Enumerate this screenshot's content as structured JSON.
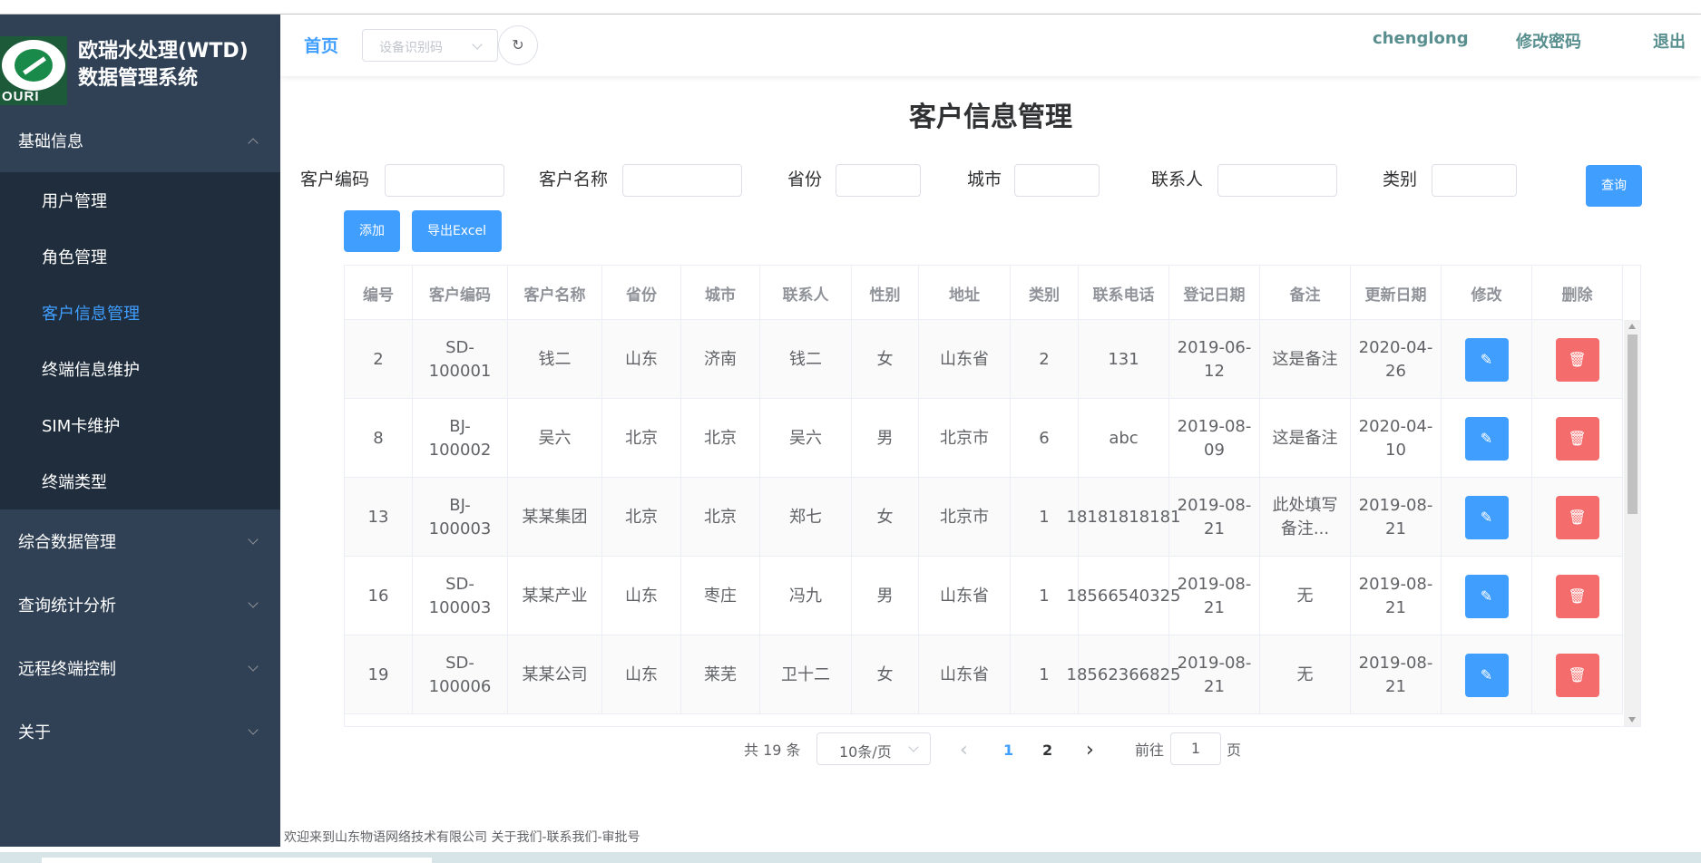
{
  "brand": {
    "logo_text": "OURI",
    "title_line1": "欧瑞水处理(WTD)",
    "title_line2": "数据管理系统"
  },
  "sidebar": {
    "groups": [
      {
        "label": "基础信息",
        "expanded": true,
        "items": [
          "用户管理",
          "角色管理",
          "客户信息管理",
          "终端信息维护",
          "SIM卡维护",
          "终端类型"
        ],
        "active_item": "客户信息管理"
      },
      {
        "label": "综合数据管理",
        "expanded": false
      },
      {
        "label": "查询统计分析",
        "expanded": false
      },
      {
        "label": "远程终端控制",
        "expanded": false
      },
      {
        "label": "关于",
        "expanded": false
      }
    ]
  },
  "header": {
    "home": "首页",
    "device_placeholder": "设备识别码",
    "refresh_icon": "↻",
    "username": "chenglong",
    "change_password": "修改密码",
    "logout": "退出"
  },
  "page_title": "客户信息管理",
  "filters": {
    "customer_code": "客户编码",
    "customer_name": "客户名称",
    "province": "省份",
    "city": "城市",
    "contact": "联系人",
    "category": "类别",
    "query_button": "查询"
  },
  "actions": {
    "add": "添加",
    "export": "导出Excel"
  },
  "table": {
    "columns": [
      "编号",
      "客户编码",
      "客户名称",
      "省份",
      "城市",
      "联系人",
      "性别",
      "地址",
      "类别",
      "联系电话",
      "登记日期",
      "备注",
      "更新日期",
      "修改",
      "删除"
    ],
    "rows": [
      {
        "id": "2",
        "code": "SD-100001",
        "name": "钱二",
        "province": "山东",
        "city": "济南",
        "contact": "钱二",
        "gender": "女",
        "address": "山东省",
        "category": "2",
        "phone": "131",
        "reg_date": "2019-06-12",
        "note": "这是备注",
        "update_date": "2020-04-26"
      },
      {
        "id": "8",
        "code": "BJ-100002",
        "name": "吴六",
        "province": "北京",
        "city": "北京",
        "contact": "吴六",
        "gender": "男",
        "address": "北京市",
        "category": "6",
        "phone": "abc",
        "reg_date": "2019-08-09",
        "note": "这是备注",
        "update_date": "2020-04-10"
      },
      {
        "id": "13",
        "code": "BJ-100003",
        "name": "某某集团",
        "province": "北京",
        "city": "北京",
        "contact": "郑七",
        "gender": "女",
        "address": "北京市",
        "category": "1",
        "phone": "18181818181",
        "reg_date": "2019-08-21",
        "note": "此处填写备注...",
        "update_date": "2019-08-21"
      },
      {
        "id": "16",
        "code": "SD-100003",
        "name": "某某产业",
        "province": "山东",
        "city": "枣庄",
        "contact": "冯九",
        "gender": "男",
        "address": "山东省",
        "category": "1",
        "phone": "18566540325",
        "reg_date": "2019-08-21",
        "note": "无",
        "update_date": "2019-08-21"
      },
      {
        "id": "19",
        "code": "SD-100006",
        "name": "某某公司",
        "province": "山东",
        "city": "莱芜",
        "contact": "卫十二",
        "gender": "女",
        "address": "山东省",
        "category": "1",
        "phone": "18562366825",
        "reg_date": "2019-08-21",
        "note": "无",
        "update_date": "2019-08-21"
      }
    ],
    "edit_icon": "✎",
    "delete_icon": "🗑"
  },
  "pagination": {
    "total": "共 19 条",
    "page_size": "10条/页",
    "prev_icon": "‹",
    "next_icon": "›",
    "pages": [
      "1",
      "2"
    ],
    "current_page": "1",
    "goto_label": "前往",
    "goto_value": "1",
    "goto_suffix": "页"
  },
  "footer": {
    "text": "欢迎来到山东物语网络技术有限公司 关于我们-联系我们-审批号"
  },
  "colors": {
    "sidebar_bg": "#304156",
    "submenu_bg": "#1f2d3d",
    "accent": "#409eff",
    "danger": "#f56c6c",
    "header_link": "#5a8f8f"
  }
}
